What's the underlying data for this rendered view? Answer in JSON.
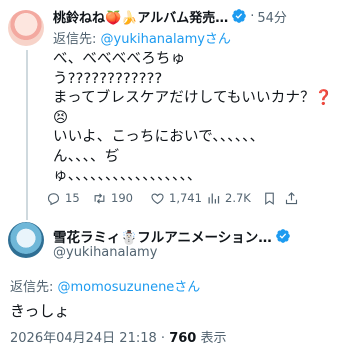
{
  "reply_tweet": {
    "display_name": "桃鈴ねね🍑🍌アルバム発売…",
    "dot": "·",
    "time": "54分",
    "reply_to_prefix": "返信先: ",
    "reply_to_handle": "@yukihanalamyさん",
    "text": "べ、べべべべろちゅ\nう????????????\nまってブレスケアだけしてもいいカナ？❓\n😣\nいいよ、こっちにおいで、、、、、、\nん、、、、ぢ\nゅ、、、、、、、、、、、、、、、、、",
    "actions": {
      "replies": "15",
      "reposts": "190",
      "likes": "1,741",
      "views": "2.7K"
    },
    "icons": [
      "reply-icon",
      "repost-icon",
      "like-icon",
      "views-icon",
      "bookmark-icon",
      "share-icon",
      "verified-icon"
    ]
  },
  "main_tweet": {
    "display_name": "雪花ラミィ☃️フルアニメーション…",
    "handle": "@yukihanalamy",
    "reply_to_prefix": "返信先: ",
    "reply_to_handle": "@momosuzuneneさん",
    "text": "きっしょ",
    "timestamp": "2026年04月24日 21:18",
    "separator": "·",
    "views_count": "760",
    "views_label": "表示"
  },
  "colors": {
    "link": "#1d9bf0",
    "secondary_text": "#536471",
    "verified": "#1d9bf0",
    "thread_line": "#cfd9de"
  }
}
